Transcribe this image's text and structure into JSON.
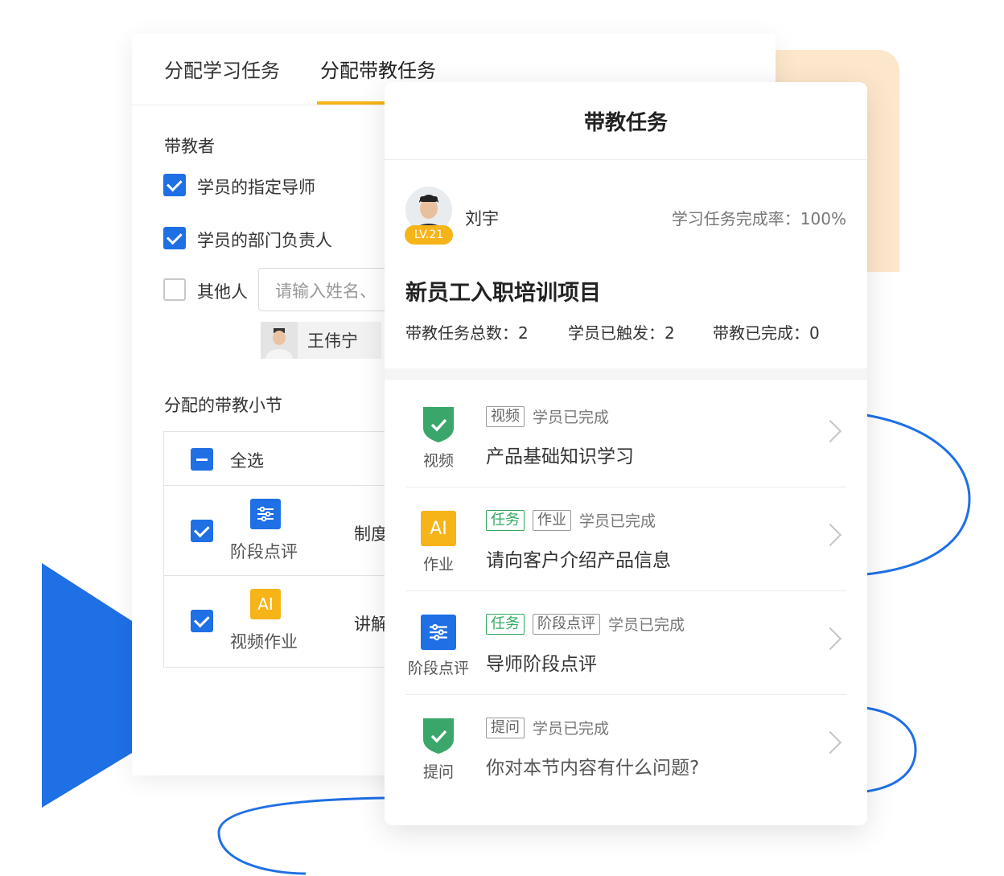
{
  "back": {
    "tabs": [
      "分配学习任务",
      "分配带教任务"
    ],
    "mentor_label": "带教者",
    "options": [
      {
        "label": "学员的指定导师",
        "checked": true
      },
      {
        "label": "学员的部门负责人",
        "checked": true
      },
      {
        "label": "其他人",
        "checked": false
      }
    ],
    "name_input_placeholder": "请输入姓名、",
    "selected_user": "王伟宁",
    "sections_label": "分配的带教小节",
    "select_all": "全选",
    "rows": [
      {
        "icon_label": "阶段点评",
        "title": "制度"
      },
      {
        "icon_label": "视频作业",
        "title": "讲解"
      }
    ]
  },
  "front": {
    "title": "带教任务",
    "user_name": "刘宇",
    "level": "LV.21",
    "completion_text": "学习任务完成率：100%",
    "project_title": "新员工入职培训项目",
    "stats": [
      "带教任务总数：2",
      "学员已触发：2",
      "带教已完成：0"
    ],
    "tasks": [
      {
        "icon": "shield-check",
        "icon_label": "视频",
        "tags": [
          {
            "text": "视频",
            "green": false
          }
        ],
        "status": "学员已完成",
        "title": "产品基础知识学习"
      },
      {
        "icon": "ai",
        "icon_label": "作业",
        "tags": [
          {
            "text": "任务",
            "green": true
          },
          {
            "text": "作业",
            "green": false
          }
        ],
        "status": "学员已完成",
        "title": "请向客户介绍产品信息"
      },
      {
        "icon": "sliders",
        "icon_label": "阶段点评",
        "tags": [
          {
            "text": "任务",
            "green": true
          },
          {
            "text": "阶段点评",
            "green": false
          }
        ],
        "status": "学员已完成",
        "title": "导师阶段点评"
      },
      {
        "icon": "shield-check",
        "icon_label": "提问",
        "tags": [
          {
            "text": "提问",
            "green": false
          }
        ],
        "status": "学员已完成",
        "title": "你对本节内容有什么问题?"
      }
    ]
  },
  "icons": {
    "ai_text": "AI"
  },
  "colors": {
    "accent_blue": "#1f6fe5",
    "accent_yellow": "#f6b419",
    "success_green": "#2eaa5c",
    "peach": "#fde7cc"
  }
}
